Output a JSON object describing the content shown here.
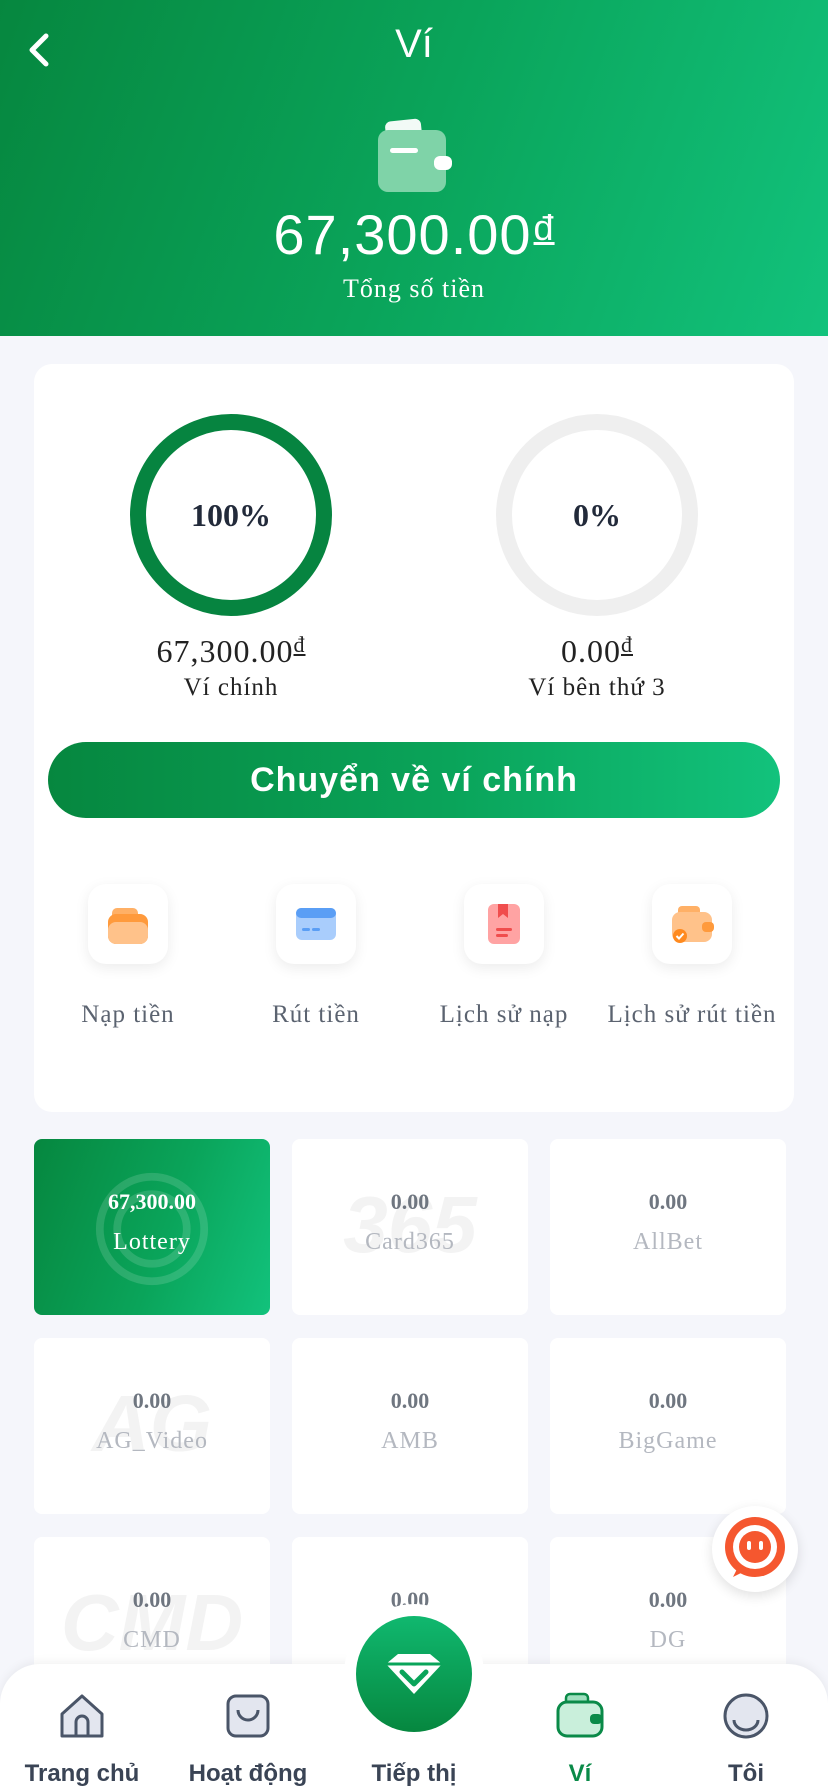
{
  "header": {
    "title": "Ví",
    "total_amount": "67,300.00",
    "currency": "đ",
    "total_label": "Tổng số tiền"
  },
  "wallets": {
    "main": {
      "percent": "100%",
      "amount": "67,300.00",
      "name": "Ví chính",
      "fill": 1.0
    },
    "third_party": {
      "percent": "0%",
      "amount": "0.00",
      "name": "Ví bên thứ 3",
      "fill": 0.0
    }
  },
  "transfer_button": "Chuyển về ví chính",
  "actions": [
    {
      "label": "Nạp tiền",
      "icon": "deposit-wallet-icon"
    },
    {
      "label": "Rút tiền",
      "icon": "card-icon"
    },
    {
      "label": "Lịch sử nạp",
      "icon": "deposit-history-icon"
    },
    {
      "label": "Lịch sử rút tiền",
      "icon": "withdraw-history-icon"
    }
  ],
  "games": [
    {
      "amount": "67,300.00",
      "name": "Lottery",
      "active": true
    },
    {
      "amount": "0.00",
      "name": "Card365"
    },
    {
      "amount": "0.00",
      "name": "AllBet"
    },
    {
      "amount": "0.00",
      "name": "AG_Video"
    },
    {
      "amount": "0.00",
      "name": "AMB"
    },
    {
      "amount": "0.00",
      "name": "BigGame"
    },
    {
      "amount": "0.00",
      "name": "CMD"
    },
    {
      "amount": "0.00",
      "name": ""
    },
    {
      "amount": "0.00",
      "name": "DG"
    }
  ],
  "nav": {
    "home": "Trang chủ",
    "activity": "Hoạt động",
    "marketing": "Tiếp thị",
    "wallet": "Ví",
    "me": "Tôi"
  },
  "colors": {
    "primary": "#06873f",
    "accent": "#12c27c"
  }
}
